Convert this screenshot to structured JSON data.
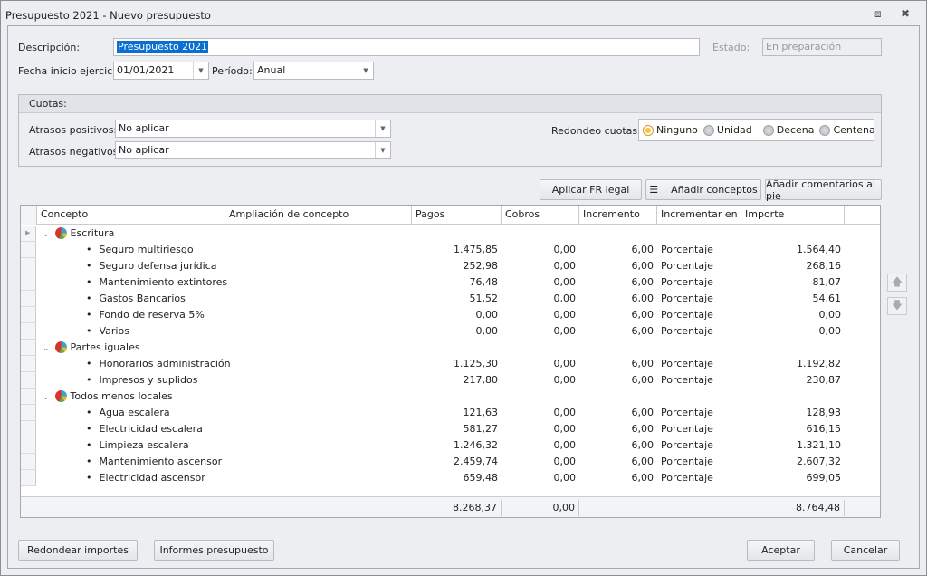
{
  "window": {
    "title": "Presupuesto 2021 - Nuevo presupuesto",
    "restore_icon": "restore-icon",
    "close_icon": "close-icon"
  },
  "form": {
    "descripcion_label": "Descripción:",
    "descripcion_value": "Presupuesto 2021",
    "estado_label": "Estado:",
    "estado_value": "En preparación",
    "fecha_label": "Fecha inicio ejercicio:",
    "fecha_value": "01/01/2021",
    "periodo_label": "Período:",
    "periodo_value": "Anual"
  },
  "cuotas": {
    "title": "Cuotas:",
    "positivos_label": "Atrasos positivos:",
    "positivos_value": "No aplicar",
    "negativos_label": "Atrasos negativos:",
    "negativos_value": "No aplicar",
    "redondeo_label": "Redondeo cuotas:",
    "options": [
      "Ninguno",
      "Unidad",
      "Decena",
      "Centena"
    ],
    "selected": "Ninguno"
  },
  "toolbar": {
    "aplicar": "Aplicar FR legal",
    "anadir": "Añadir conceptos",
    "comentarios": "Añadir comentarios al pie"
  },
  "grid": {
    "columns": [
      "Concepto",
      "Ampliación de concepto",
      "Pagos",
      "Cobros",
      "Incremento",
      "Incrementar en",
      "Importe"
    ],
    "rows": [
      {
        "group": true,
        "concepto": "Escritura"
      },
      {
        "concepto": "Seguro multiriesgo",
        "pagos": "1.475,85",
        "cobros": "0,00",
        "incremento": "6,00",
        "en": "Porcentaje",
        "importe": "1.564,40"
      },
      {
        "concepto": "Seguro defensa jurídica",
        "pagos": "252,98",
        "cobros": "0,00",
        "incremento": "6,00",
        "en": "Porcentaje",
        "importe": "268,16"
      },
      {
        "concepto": "Mantenimiento extintores",
        "pagos": "76,48",
        "cobros": "0,00",
        "incremento": "6,00",
        "en": "Porcentaje",
        "importe": "81,07"
      },
      {
        "concepto": "Gastos Bancarios",
        "pagos": "51,52",
        "cobros": "0,00",
        "incremento": "6,00",
        "en": "Porcentaje",
        "importe": "54,61"
      },
      {
        "concepto": "Fondo de reserva 5%",
        "pagos": "0,00",
        "cobros": "0,00",
        "incremento": "6,00",
        "en": "Porcentaje",
        "importe": "0,00"
      },
      {
        "concepto": "Varios",
        "pagos": "0,00",
        "cobros": "0,00",
        "incremento": "6,00",
        "en": "Porcentaje",
        "importe": "0,00"
      },
      {
        "group": true,
        "concepto": "Partes iguales"
      },
      {
        "concepto": "Honorarios administración",
        "pagos": "1.125,30",
        "cobros": "0,00",
        "incremento": "6,00",
        "en": "Porcentaje",
        "importe": "1.192,82"
      },
      {
        "concepto": "Impresos y suplidos",
        "pagos": "217,80",
        "cobros": "0,00",
        "incremento": "6,00",
        "en": "Porcentaje",
        "importe": "230,87"
      },
      {
        "group": true,
        "concepto": "Todos menos locales"
      },
      {
        "concepto": "Agua escalera",
        "pagos": "121,63",
        "cobros": "0,00",
        "incremento": "6,00",
        "en": "Porcentaje",
        "importe": "128,93"
      },
      {
        "concepto": "Electricidad escalera",
        "pagos": "581,27",
        "cobros": "0,00",
        "incremento": "6,00",
        "en": "Porcentaje",
        "importe": "616,15"
      },
      {
        "concepto": "Limpieza escalera",
        "pagos": "1.246,32",
        "cobros": "0,00",
        "incremento": "6,00",
        "en": "Porcentaje",
        "importe": "1.321,10"
      },
      {
        "concepto": "Mantenimiento ascensor",
        "pagos": "2.459,74",
        "cobros": "0,00",
        "incremento": "6,00",
        "en": "Porcentaje",
        "importe": "2.607,32"
      },
      {
        "concepto": "Electricidad ascensor",
        "pagos": "659,48",
        "cobros": "0,00",
        "incremento": "6,00",
        "en": "Porcentaje",
        "importe": "699,05"
      }
    ],
    "totals": {
      "pagos": "8.268,37",
      "cobros": "0,00",
      "importe": "8.764,48"
    }
  },
  "footer": {
    "redondear": "Redondear importes",
    "informes": "Informes presupuesto",
    "aceptar": "Aceptar",
    "cancelar": "Cancelar"
  }
}
